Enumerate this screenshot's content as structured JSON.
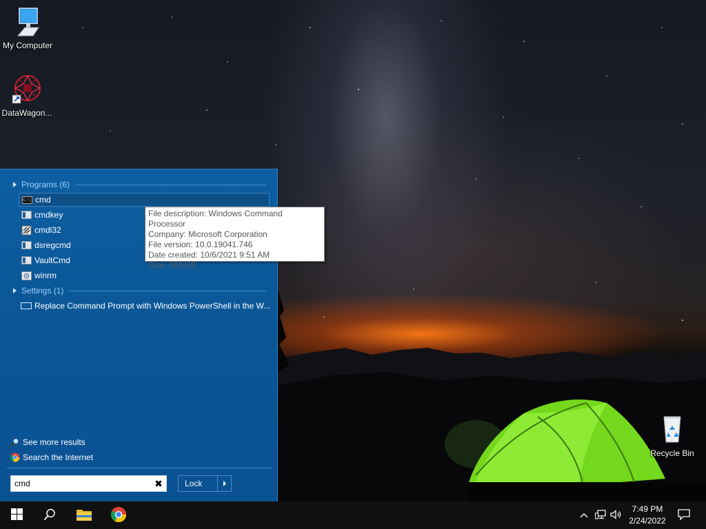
{
  "desktop": {
    "icons": [
      {
        "label": "My Computer",
        "icon": "computer-icon"
      },
      {
        "label": "DataWagon...",
        "icon": "datawagon-shortcut-icon"
      },
      {
        "label": "Recycle Bin",
        "icon": "recycle-bin-icon"
      }
    ]
  },
  "start_menu": {
    "programs_header": "Programs (6)",
    "programs": [
      {
        "label": "cmd",
        "icon": "console-icon",
        "selected": true
      },
      {
        "label": "cmdkey",
        "icon": "app-icon"
      },
      {
        "label": "cmdl32",
        "icon": "network-tool-icon"
      },
      {
        "label": "dsregcmd",
        "icon": "app-icon"
      },
      {
        "label": "VaultCmd",
        "icon": "app-icon"
      },
      {
        "label": "winrm",
        "icon": "script-icon"
      }
    ],
    "settings_header": "Settings (1)",
    "settings": [
      {
        "label": "Replace Command Prompt with Windows PowerShell in the W...",
        "icon": "settings-page-icon"
      }
    ],
    "footer_links": [
      {
        "label": "See more results",
        "icon": "magnifier-icon"
      },
      {
        "label": "Search the Internet",
        "icon": "chrome-icon"
      }
    ],
    "search": {
      "value": "cmd",
      "clear_icon": "close-icon"
    },
    "power_button": {
      "label": "Lock",
      "arrow_icon": "chevron-right-icon"
    }
  },
  "tooltip": {
    "lines": [
      "File description: Windows Command Processor",
      "Company: Microsoft Corporation",
      "File version: 10.0.19041.746",
      "Date created: 10/6/2021 9:51 AM",
      "Size: 283 KB"
    ]
  },
  "taskbar": {
    "buttons": [
      {
        "name": "start",
        "icon": "windows-logo-icon"
      },
      {
        "name": "search",
        "icon": "search-icon"
      },
      {
        "name": "file-explorer",
        "icon": "folder-icon"
      },
      {
        "name": "chrome",
        "icon": "chrome-icon"
      }
    ],
    "tray": {
      "icons": [
        "chevron-up-icon",
        "network-icon",
        "speaker-icon"
      ],
      "time": "7:49 PM",
      "date": "2/24/2022",
      "notification_icon": "action-center-icon"
    }
  },
  "colors": {
    "start_menu_bg": "#0b5797",
    "group_header": "#9ed0ff",
    "taskbar_bg": "#101010",
    "tent_green": "#7ee01e"
  }
}
